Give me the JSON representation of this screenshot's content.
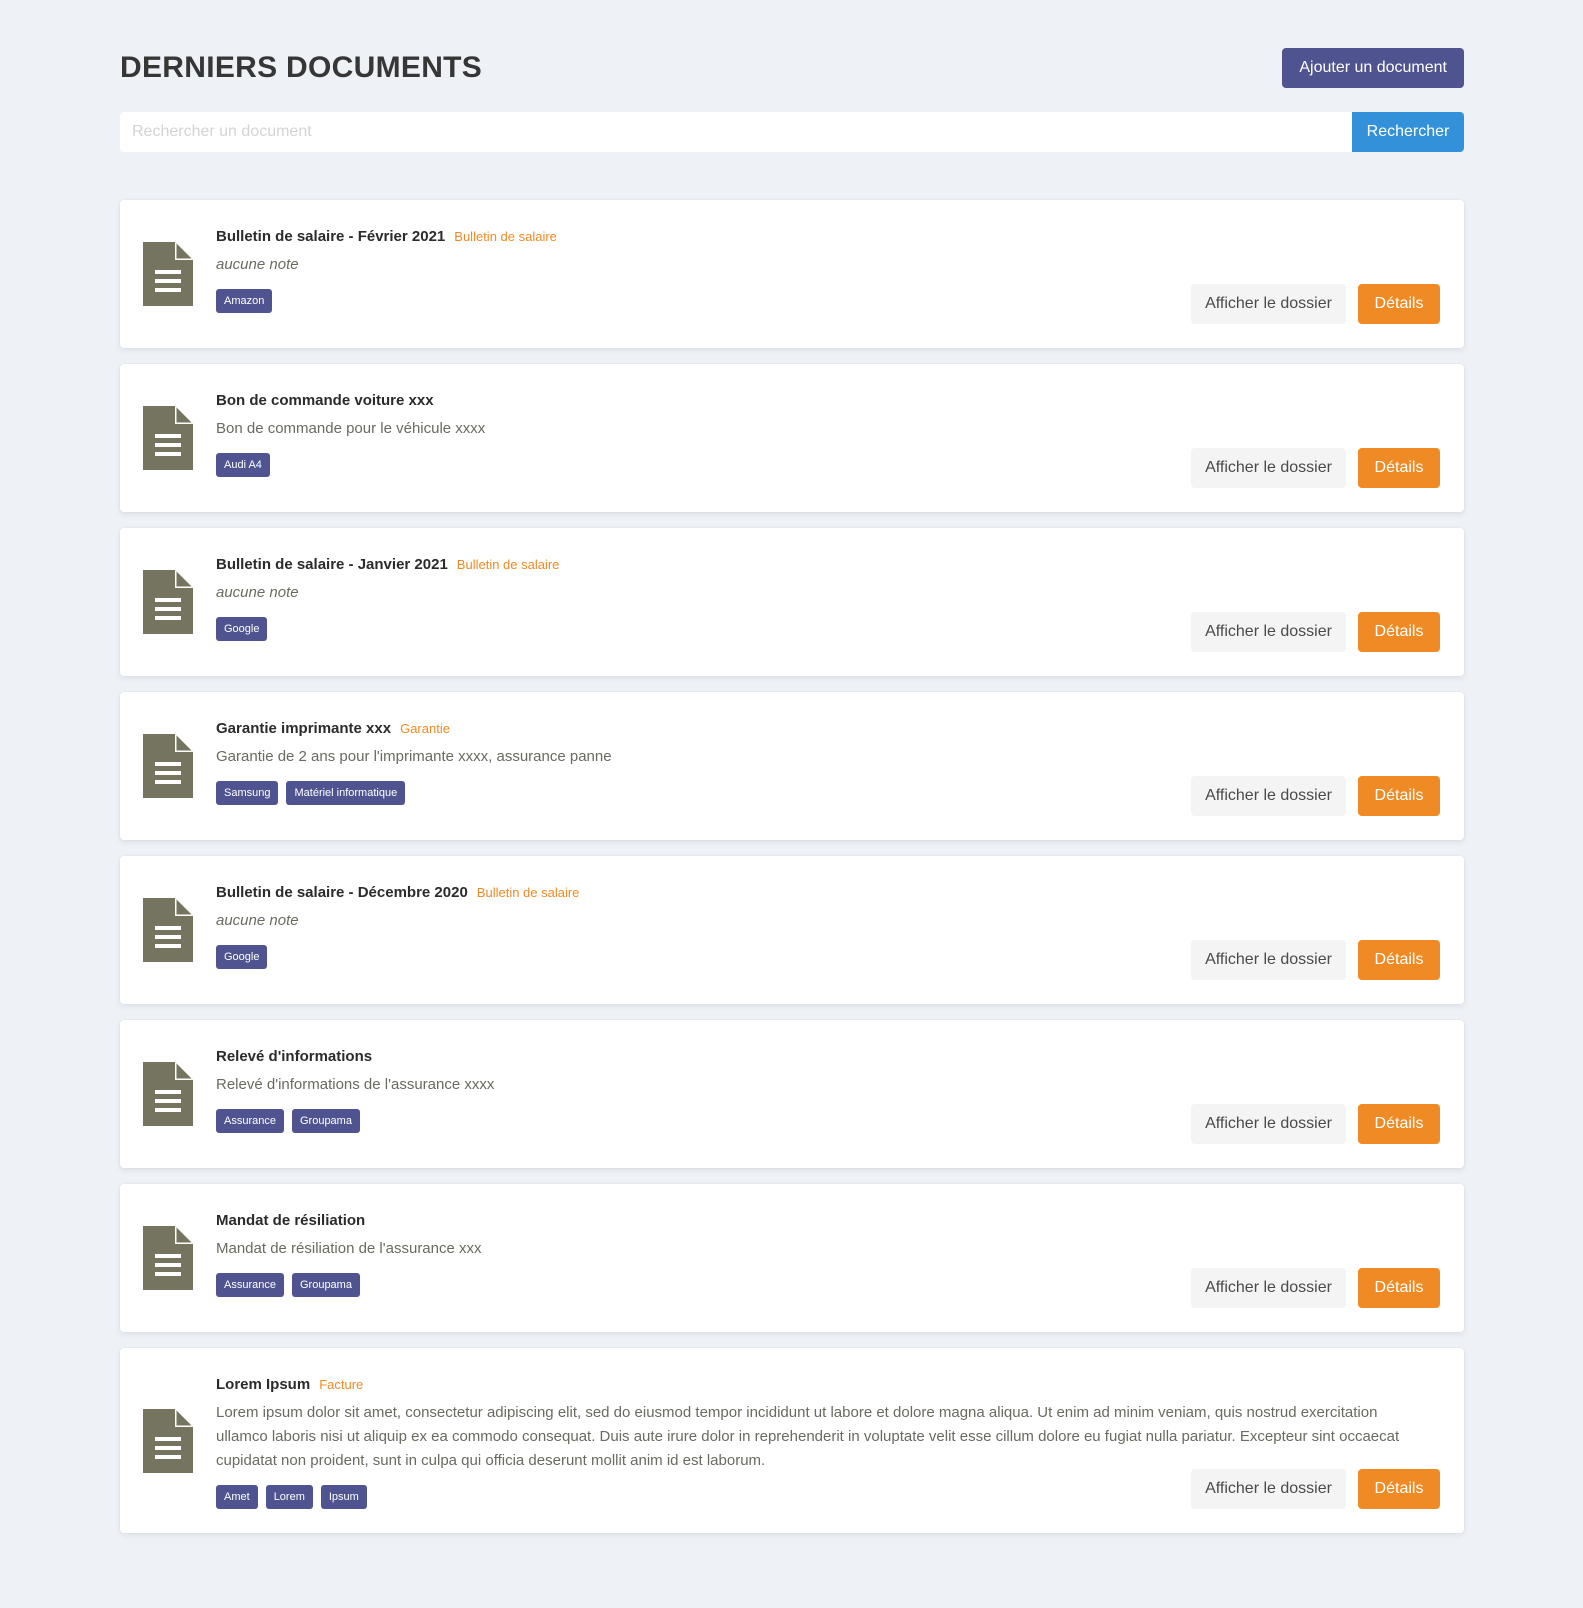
{
  "header": {
    "title": "DERNIERS DOCUMENTS",
    "add_button": "Ajouter un document"
  },
  "search": {
    "placeholder": "Rechercher un document",
    "value": "",
    "button": "Rechercher"
  },
  "card_actions": {
    "folder_button": "Afficher le dossier",
    "details_button": "Détails"
  },
  "icon": "file-document-icon",
  "colors": {
    "primary": "#4f5491",
    "accent": "#f08a24",
    "search": "#3291d8",
    "icon": "#75755f",
    "background": "#eef1f6"
  },
  "documents": [
    {
      "title": "Bulletin de salaire - Février 2021",
      "category": "Bulletin de salaire",
      "note": "aucune note",
      "note_empty": true,
      "tags": [
        "Amazon"
      ]
    },
    {
      "title": "Bon de commande voiture xxx",
      "category": "",
      "note": "Bon de commande pour le véhicule xxxx",
      "note_empty": false,
      "tags": [
        "Audi A4"
      ]
    },
    {
      "title": "Bulletin de salaire - Janvier 2021",
      "category": "Bulletin de salaire",
      "note": "aucune note",
      "note_empty": true,
      "tags": [
        "Google"
      ]
    },
    {
      "title": "Garantie imprimante xxx",
      "category": "Garantie",
      "note": "Garantie de 2 ans pour l'imprimante xxxx, assurance panne",
      "note_empty": false,
      "tags": [
        "Samsung",
        "Matériel informatique"
      ]
    },
    {
      "title": "Bulletin de salaire - Décembre 2020",
      "category": "Bulletin de salaire",
      "note": "aucune note",
      "note_empty": true,
      "tags": [
        "Google"
      ]
    },
    {
      "title": "Relevé d'informations",
      "category": "",
      "note": "Relevé d'informations de l'assurance xxxx",
      "note_empty": false,
      "tags": [
        "Assurance",
        "Groupama"
      ]
    },
    {
      "title": "Mandat de résiliation",
      "category": "",
      "note": "Mandat de résiliation de l'assurance xxx",
      "note_empty": false,
      "tags": [
        "Assurance",
        "Groupama"
      ]
    },
    {
      "title": "Lorem Ipsum",
      "category": "Facture",
      "note": "Lorem ipsum dolor sit amet, consectetur adipiscing elit, sed do eiusmod tempor incididunt ut labore et dolore magna aliqua. Ut enim ad minim veniam, quis nostrud exercitation ullamco laboris nisi ut aliquip ex ea commodo consequat. Duis aute irure dolor in reprehenderit in voluptate velit esse cillum dolore eu fugiat nulla pariatur. Excepteur sint occaecat cupidatat non proident, sunt in culpa qui officia deserunt mollit anim id est laborum.",
      "note_empty": false,
      "tags": [
        "Amet",
        "Lorem",
        "Ipsum"
      ]
    }
  ]
}
